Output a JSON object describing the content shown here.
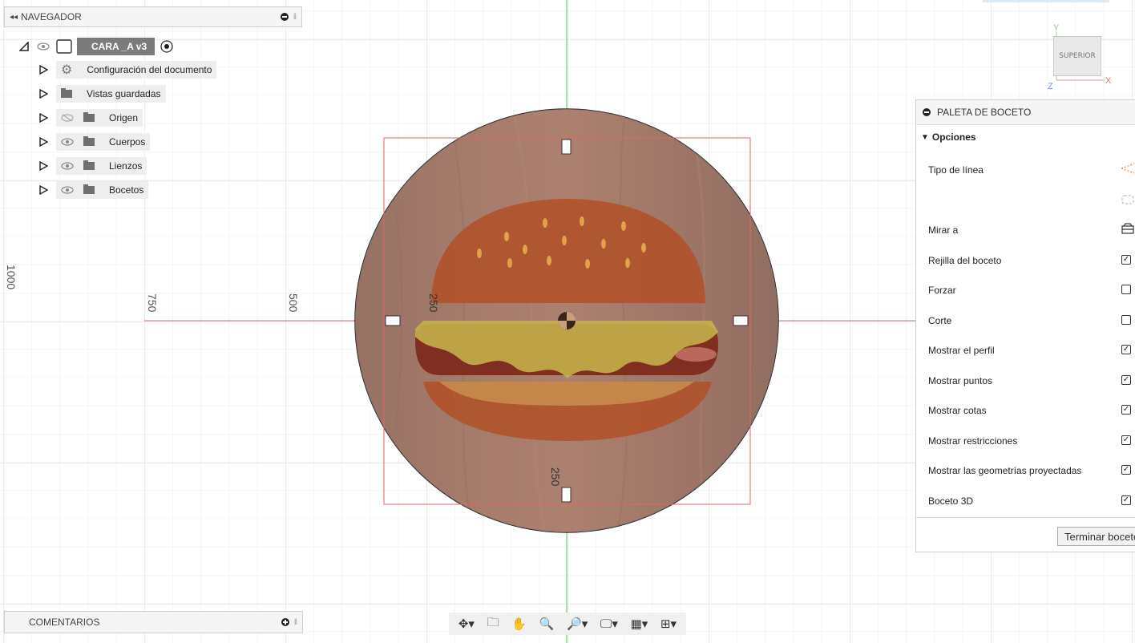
{
  "navigator": {
    "title": "NAVEGADOR",
    "root_label": "CARA _A v3",
    "items": [
      {
        "label": "Configuración del documento",
        "icon": "gear-icon"
      },
      {
        "label": "Vistas guardadas",
        "icon": "folder-icon"
      },
      {
        "label": "Origen",
        "icon": "folder-icon",
        "visibility": "hidden"
      },
      {
        "label": "Cuerpos",
        "icon": "folder-icon",
        "visibility": "visible"
      },
      {
        "label": "Lienzos",
        "icon": "folder-icon",
        "visibility": "visible"
      },
      {
        "label": "Bocetos",
        "icon": "folder-icon",
        "visibility": "visible"
      }
    ]
  },
  "comments": {
    "title": "COMENTARIOS"
  },
  "viewcube": {
    "face": "SUPERIOR",
    "axis_x": "X",
    "axis_y": "Y",
    "axis_z": "Z"
  },
  "canvas": {
    "left_label": "1000",
    "dim_750": "750",
    "dim_500": "500",
    "dim_250_top": "250",
    "dim_250_bottom": "250"
  },
  "palette": {
    "title": "PALETA DE BOCETO",
    "section": "Opciones",
    "options": [
      {
        "label": "Tipo de línea"
      },
      {
        "label": "Mirar a"
      },
      {
        "label": "Rejilla del boceto",
        "checked": true
      },
      {
        "label": "Forzar",
        "checked": false
      },
      {
        "label": "Corte",
        "checked": false
      },
      {
        "label": "Mostrar el perfil",
        "checked": true
      },
      {
        "label": "Mostrar puntos",
        "checked": true
      },
      {
        "label": "Mostrar cotas",
        "checked": true
      },
      {
        "label": "Mostrar restricciones",
        "checked": true
      },
      {
        "label": "Mostrar las geometrías proyectadas",
        "checked": true
      },
      {
        "label": "Boceto 3D",
        "checked": true
      }
    ],
    "finish_label": "Terminar boceto"
  },
  "colors": {
    "grid": "#e6e6e6",
    "sketch_red": "#e06666",
    "axis_green": "#6fd36f",
    "wood": "#6b3a22"
  }
}
